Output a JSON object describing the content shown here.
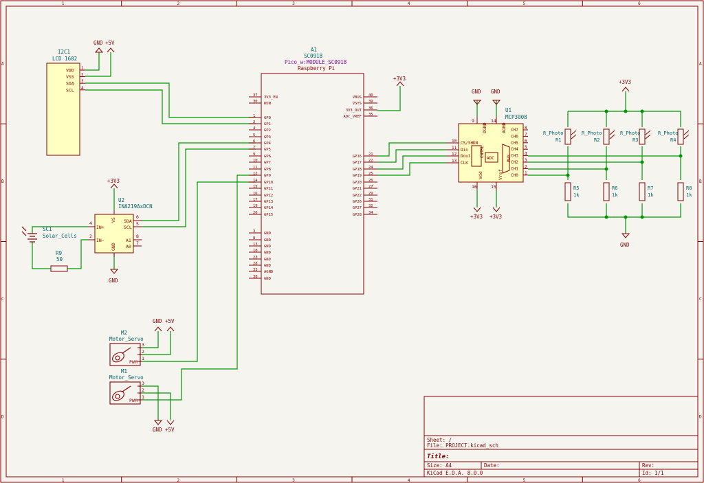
{
  "colors": {
    "background": "#f5f4ef",
    "frame": "#840000",
    "wire": "#009600",
    "component": "#840000",
    "component_fill": "#ffffc2",
    "reference": "#006464",
    "pin_text": "#840000",
    "power": "#840000"
  },
  "frame": {
    "columns": [
      "1",
      "2",
      "3",
      "4",
      "5",
      "6"
    ],
    "rows": [
      "A",
      "B",
      "C",
      "D"
    ]
  },
  "lcd": {
    "ref": "I2C1",
    "value": "LCD 1602",
    "pins": [
      {
        "num": "1",
        "name": "VDD"
      },
      {
        "num": "2",
        "name": "VSS"
      },
      {
        "num": "3",
        "name": "SDA"
      },
      {
        "num": "4",
        "name": "SCL"
      }
    ]
  },
  "pico": {
    "ref": "A1",
    "value": "SC0918",
    "footprint": "Pico_w:MODULE_SC0918",
    "desc": "Raspberry Pi",
    "left_pins": [
      {
        "num": "37",
        "name": "3V3_EN"
      },
      {
        "num": "30",
        "name": "RUN"
      },
      {
        "num": "1",
        "name": "GP0"
      },
      {
        "num": "2",
        "name": "GP1"
      },
      {
        "num": "4",
        "name": "GP2"
      },
      {
        "num": "5",
        "name": "GP3"
      },
      {
        "num": "6",
        "name": "GP4"
      },
      {
        "num": "7",
        "name": "GP5"
      },
      {
        "num": "9",
        "name": "GP6"
      },
      {
        "num": "10",
        "name": "GP7"
      },
      {
        "num": "11",
        "name": "GP8"
      },
      {
        "num": "12",
        "name": "GP9"
      },
      {
        "num": "14",
        "name": "GP10"
      },
      {
        "num": "15",
        "name": "GP11"
      },
      {
        "num": "16",
        "name": "GP12"
      },
      {
        "num": "17",
        "name": "GP13"
      },
      {
        "num": "19",
        "name": "GP14"
      },
      {
        "num": "20",
        "name": "GP15"
      },
      {
        "num": "3",
        "name": "GND"
      },
      {
        "num": "8",
        "name": "GND"
      },
      {
        "num": "13",
        "name": "GND"
      },
      {
        "num": "18",
        "name": "GND"
      },
      {
        "num": "23",
        "name": "GND"
      },
      {
        "num": "28",
        "name": "GND"
      },
      {
        "num": "33",
        "name": "AGND"
      },
      {
        "num": "38",
        "name": "GND"
      }
    ],
    "right_pins": [
      {
        "num": "40",
        "name": "VBUS"
      },
      {
        "num": "39",
        "name": "VSYS"
      },
      {
        "num": "36",
        "name": "3V3_OUT"
      },
      {
        "num": "35",
        "name": "ADC_VREF"
      },
      {
        "num": "21",
        "name": "GP16"
      },
      {
        "num": "22",
        "name": "GP17"
      },
      {
        "num": "24",
        "name": "GP18"
      },
      {
        "num": "25",
        "name": "GP19"
      },
      {
        "num": "26",
        "name": "GP20"
      },
      {
        "num": "27",
        "name": "GP21"
      },
      {
        "num": "29",
        "name": "GP22"
      },
      {
        "num": "31",
        "name": "GP26"
      },
      {
        "num": "32",
        "name": "GP27"
      },
      {
        "num": "34",
        "name": "GP28"
      }
    ]
  },
  "ina": {
    "ref": "U2",
    "value": "INA219AxDCN",
    "pins": [
      {
        "num": "4",
        "name": "IN+"
      },
      {
        "num": "2",
        "name": "IN-"
      },
      {
        "num": "6",
        "name": "SDA"
      },
      {
        "num": "5",
        "name": "SCL"
      },
      {
        "num": "8",
        "name": "A1"
      },
      {
        "num": "7",
        "name": "A0"
      },
      {
        "num": "3",
        "name": "VS"
      },
      {
        "num": "1",
        "name": "GND"
      }
    ]
  },
  "solar": {
    "ref": "SC1",
    "value": "Solar_Cells"
  },
  "r9": {
    "ref": "R9",
    "value": "50"
  },
  "mcp": {
    "ref": "U1",
    "value": "MCP3008",
    "left_pins": [
      {
        "num": "10",
        "name": "CS/SHDN"
      },
      {
        "num": "11",
        "name": "Din"
      },
      {
        "num": "12",
        "name": "Dout"
      },
      {
        "num": "13",
        "name": "CLK"
      }
    ],
    "right_pins": [
      {
        "num": "8",
        "name": "CH7"
      },
      {
        "num": "7",
        "name": "CH6"
      },
      {
        "num": "6",
        "name": "CH5"
      },
      {
        "num": "5",
        "name": "CH4"
      },
      {
        "num": "4",
        "name": "CH3"
      },
      {
        "num": "3",
        "name": "CH2"
      },
      {
        "num": "2",
        "name": "CH1"
      },
      {
        "num": "1",
        "name": "CH0"
      }
    ],
    "top_pins": [
      {
        "num": "9",
        "name": "DGND"
      },
      {
        "num": "14",
        "name": "AGND"
      }
    ],
    "bottom_pins": [
      {
        "num": "16",
        "name": "Vdd"
      },
      {
        "num": "15",
        "name": "Vref"
      }
    ],
    "inner": [
      "CNTRL",
      "ADC",
      "MUX"
    ]
  },
  "photo": [
    {
      "ref": "R1",
      "value": "R_Photo"
    },
    {
      "ref": "R2",
      "value": "R_Photo"
    },
    {
      "ref": "R3",
      "value": "R_Photo"
    },
    {
      "ref": "R4",
      "value": "R_Photo"
    }
  ],
  "pulldown": [
    {
      "ref": "R5",
      "value": "1k"
    },
    {
      "ref": "R6",
      "value": "1k"
    },
    {
      "ref": "R7",
      "value": "1k"
    },
    {
      "ref": "R8",
      "value": "1k"
    }
  ],
  "servos": [
    {
      "ref": "M2",
      "value": "Motor_Servo",
      "pwm": "PWM",
      "pins": [
        "3",
        "2",
        "1"
      ]
    },
    {
      "ref": "M1",
      "value": "Motor_Servo",
      "pwm": "PWM",
      "pins": [
        "3",
        "2",
        "1"
      ]
    }
  ],
  "power": {
    "gnd": "GND",
    "p5v": "+5V",
    "p3v3": "+3V3"
  },
  "title_block": {
    "sheet": "Sheet: /",
    "file": "File: PROJECT.kicad_sch",
    "title": "Title:",
    "size": "Size: A4",
    "date": "Date:",
    "rev": "Rev:",
    "tool": "KiCad E.D.A. 8.0.0",
    "id": "Id: 1/1"
  }
}
